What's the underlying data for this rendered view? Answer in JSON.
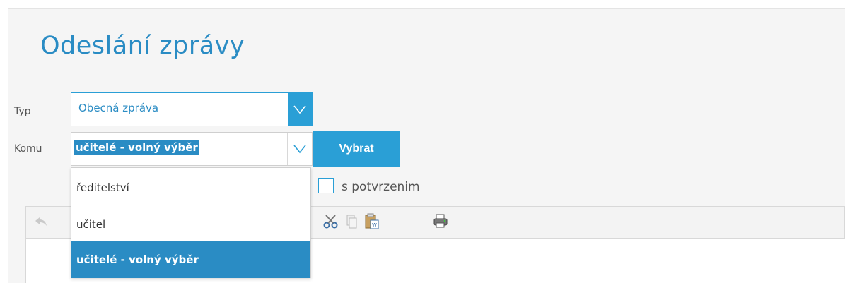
{
  "page": {
    "title": "Odeslání zprávy"
  },
  "form": {
    "typ": {
      "label": "Typ",
      "value": "Obecná zpráva"
    },
    "komu": {
      "label": "Komu",
      "value": "učitelé - volný výběr"
    },
    "vybrat_label": "Vybrat",
    "confirm_label": "s potvrzenim"
  },
  "dropdown": {
    "items": [
      {
        "label": "ředitelství",
        "selected": false
      },
      {
        "label": "učitel",
        "selected": false
      },
      {
        "label": "učitelé - volný výběr",
        "selected": true
      }
    ]
  },
  "toolbar": {
    "icons": [
      "undo-icon",
      "cut-icon",
      "copy-icon",
      "paste-from-word-icon",
      "print-icon"
    ]
  },
  "colors": {
    "accent": "#2a9fd6",
    "selected": "#2a8cc4",
    "title": "#2a8cc4"
  }
}
